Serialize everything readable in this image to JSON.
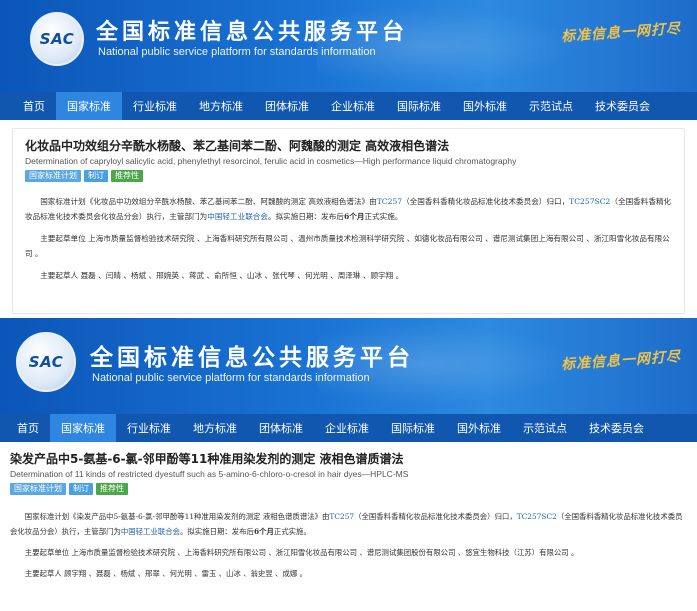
{
  "site": {
    "logo": "SAC",
    "title": "全国标准信息公共服务平台",
    "subtitle": "National public service platform  for standards information",
    "slogan": "标准信息一网打尽"
  },
  "nav": [
    {
      "label": "首页",
      "active": false
    },
    {
      "label": "国家标准",
      "active": true
    },
    {
      "label": "行业标准",
      "active": false
    },
    {
      "label": "地方标准",
      "active": false
    },
    {
      "label": "团体标准",
      "active": false
    },
    {
      "label": "企业标准",
      "active": false
    },
    {
      "label": "国际标准",
      "active": false
    },
    {
      "label": "国外标准",
      "active": false
    },
    {
      "label": "示范试点",
      "active": false
    },
    {
      "label": "技术委员会",
      "active": false
    }
  ],
  "tags": {
    "plan": "国家标准计划",
    "method": "制订",
    "recommended": "推荐性"
  },
  "plan1": {
    "title": "化妆品中功效组分辛酰水杨酸、苯乙基间苯二酚、阿魏酸的测定 高效液相色谱法",
    "title_en": "Determination of capryloyl salicylic acid, phenylethyl resorcinol, ferulic acid in cosmetics—High performance liquid chromatography",
    "p1_a": "国家标准计划《化妆品中功效组分辛酰水杨酸、苯乙基间苯二酚、阿魏酸的测定 高效液相色谱法》由",
    "p1_tc": "TC257",
    "p1_b": "（全国香料香精化妆品标准化技术委员会）归口，",
    "p1_sc": "TC257SC2",
    "p1_c": "（全国香料香精化妆品标准化技术委员会化妆品分会）执行，主管部门为",
    "p1_dept": "中国轻工业联合会",
    "p1_d": "。拟实施日期：发布后",
    "p1_months": "6个月",
    "p1_e": "正式实施。",
    "p2": "主要起草单位 上海市质量监督检验技术研究院 、上海香料研究所有限公司 、温州市质量技术检测科学研究院 、如德化妆品有限公司 、谱尼测试集团上海有限公司 、浙江阳雪化妆品有限公司 。",
    "p3": "主要起草人 聂磊 、闫晴 、杨斌 、邢婉英 、蒋武 、俞所恒 、山冰 、张代琴 、何光明 、周泽琳 、顾宇翔 。"
  },
  "plan2": {
    "title": "染发产品中5-氨基-6-氯-邻甲酚等11种准用染发剂的测定 液相色谱质谱法",
    "title_en": "Determination of 11 kinds of restricted dyestuff such as 5-amino-6-chloro-o-cresol in hair dyes—HPLC-MS",
    "p1_a": "国家标准计划《染发产品中5-氨基-6-氯-邻甲酚等11种准用染发剂的测定 液相色谱质谱法》由",
    "p1_tc": "TC257",
    "p1_b": "（全国香料香精化妆品标准化技术委员会）归口，",
    "p1_sc": "TC257SC2",
    "p1_c": "（全国香料香精化妆品标准化技术委员会化妆品分会）执行，主管部门为",
    "p1_dept": "中国轻工业联合会",
    "p1_d": "。拟实施日期：发布后",
    "p1_months": "6个月",
    "p1_e": "正式实施。",
    "p2": "主要起草单位 上海市质量监督检验技术研究院 、上海香料研究所有限公司 、浙江阳雪化妆品有限公司 、谱尼测试集团股份有限公司 、悠宜生物科技（江苏）有限公司 。",
    "p3": "主要起草人 顾宇翔 、聂磊 、杨斌 、邢翠 、何光明 、雷玉 、山冰 、翁史昱 、成娜 。"
  }
}
